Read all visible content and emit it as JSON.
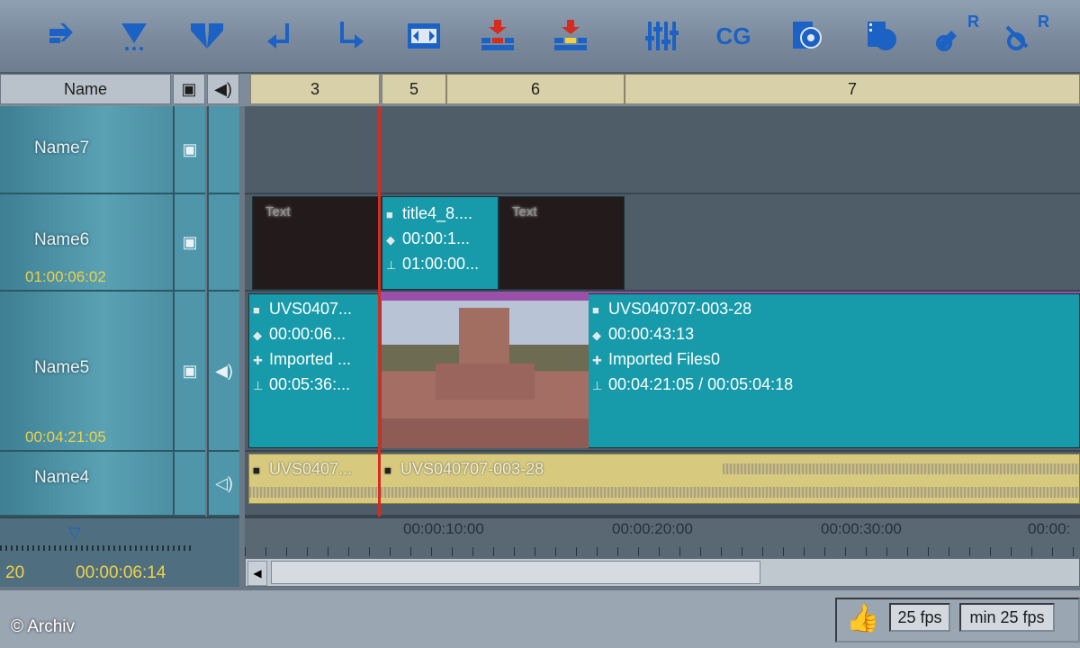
{
  "toolbar": {
    "icons": [
      "arrow-right-icon",
      "marker-down-icon",
      "split-down-icon",
      "return-left-icon",
      "return-down-right-icon",
      "fit-timeline-icon",
      "insert-red-icon",
      "insert-yellow-icon",
      "mixer-icon",
      "cg-icon",
      "effect-film-icon",
      "film-record-icon",
      "link-r-icon",
      "unlink-r-icon"
    ],
    "cg_label": "CG",
    "r_label": "R"
  },
  "header": {
    "name_col": "Name",
    "ruler_labels": [
      "3",
      "5",
      "6",
      "7"
    ]
  },
  "tracks": [
    {
      "name": "Name7",
      "tc": ""
    },
    {
      "name": "Name6",
      "tc": "01:00:06:02"
    },
    {
      "name": "Name5",
      "tc": "00:04:21:05"
    },
    {
      "name": "Name4",
      "tc": ""
    }
  ],
  "clips": {
    "title_clip": {
      "l1": "title4_8....",
      "l2": "00:00:1...",
      "l3": "01:00:00..."
    },
    "ghost_text": "Text",
    "v_clip_a": {
      "l1": "UVS0407...",
      "l2": "00:00:06...",
      "l3": "Imported ...",
      "l4": "00:05:36:..."
    },
    "v_clip_b": {
      "l1": "UVS040707-003-28",
      "l2": "00:00:43:13",
      "l3": "Imported Files0",
      "l4": "00:04:21:05 / 00:05:04:18"
    },
    "a_clip_a": "UVS0407...",
    "a_clip_b": "UVS040707-003-28"
  },
  "bottom": {
    "left_num": "20",
    "left_tc": "00:00:06:14",
    "ruler": [
      "00:00:10:00",
      "00:00:20:00",
      "00:00:30:00",
      "00:00:"
    ],
    "fps1": "25 fps",
    "fps2": "min 25 fps",
    "copyright": "© Archiv"
  },
  "colors": {
    "playhead": "#d62b1e",
    "clip": "#179aa9",
    "audio": "#d7ca7e",
    "accent": "#1b62c4"
  }
}
